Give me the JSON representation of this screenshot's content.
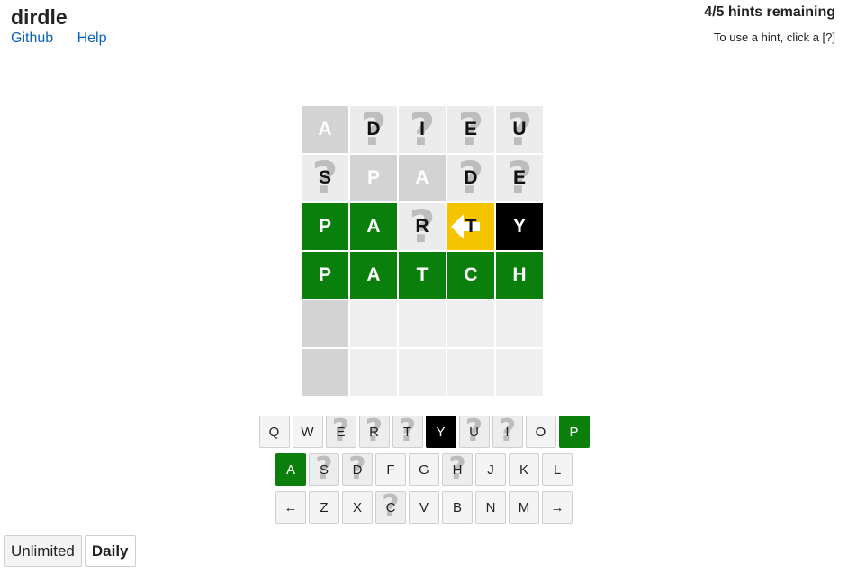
{
  "app": {
    "title": "dirdle"
  },
  "links": [
    {
      "label": "Github"
    },
    {
      "label": "Help"
    }
  ],
  "hints": {
    "remaining": "4/5 hints remaining",
    "help": "To use a hint, click a [?]"
  },
  "colors": {
    "green": "#0b7f0b",
    "yellow": "#f5c400",
    "gray": "#d3d3d3",
    "black": "#000000",
    "link": "#0b62b8"
  },
  "grid": [
    [
      {
        "letter": "A",
        "state": "gray"
      },
      {
        "letter": "D",
        "state": "unknown"
      },
      {
        "letter": "I",
        "state": "unknown"
      },
      {
        "letter": "E",
        "state": "unknown"
      },
      {
        "letter": "U",
        "state": "unknown"
      }
    ],
    [
      {
        "letter": "S",
        "state": "unknown"
      },
      {
        "letter": "P",
        "state": "gray"
      },
      {
        "letter": "A",
        "state": "gray"
      },
      {
        "letter": "D",
        "state": "unknown"
      },
      {
        "letter": "E",
        "state": "unknown"
      }
    ],
    [
      {
        "letter": "P",
        "state": "green"
      },
      {
        "letter": "A",
        "state": "green"
      },
      {
        "letter": "R",
        "state": "unknown"
      },
      {
        "letter": "T",
        "state": "yellow",
        "icon": "left-arrow-icon"
      },
      {
        "letter": "Y",
        "state": "black"
      }
    ],
    [
      {
        "letter": "P",
        "state": "green"
      },
      {
        "letter": "A",
        "state": "green"
      },
      {
        "letter": "T",
        "state": "green"
      },
      {
        "letter": "C",
        "state": "green"
      },
      {
        "letter": "H",
        "state": "green"
      }
    ],
    [
      {
        "letter": "",
        "state": "first-empty"
      },
      {
        "letter": "",
        "state": "empty"
      },
      {
        "letter": "",
        "state": "empty"
      },
      {
        "letter": "",
        "state": "empty"
      },
      {
        "letter": "",
        "state": "empty"
      }
    ],
    [
      {
        "letter": "",
        "state": "first-empty"
      },
      {
        "letter": "",
        "state": "empty"
      },
      {
        "letter": "",
        "state": "empty"
      },
      {
        "letter": "",
        "state": "empty"
      },
      {
        "letter": "",
        "state": "empty"
      }
    ]
  ],
  "keyboard": [
    [
      {
        "key": "Q",
        "state": "plain"
      },
      {
        "key": "W",
        "state": "plain"
      },
      {
        "key": "E",
        "state": "unknown"
      },
      {
        "key": "R",
        "state": "unknown"
      },
      {
        "key": "T",
        "state": "unknown"
      },
      {
        "key": "Y",
        "state": "black"
      },
      {
        "key": "U",
        "state": "unknown"
      },
      {
        "key": "I",
        "state": "unknown"
      },
      {
        "key": "O",
        "state": "plain"
      },
      {
        "key": "P",
        "state": "green"
      }
    ],
    [
      {
        "key": "A",
        "state": "green"
      },
      {
        "key": "S",
        "state": "unknown"
      },
      {
        "key": "D",
        "state": "unknown"
      },
      {
        "key": "F",
        "state": "plain"
      },
      {
        "key": "G",
        "state": "plain"
      },
      {
        "key": "H",
        "state": "unknown"
      },
      {
        "key": "J",
        "state": "plain"
      },
      {
        "key": "K",
        "state": "plain"
      },
      {
        "key": "L",
        "state": "plain"
      }
    ],
    [
      {
        "key": "←",
        "state": "plain"
      },
      {
        "key": "Z",
        "state": "plain"
      },
      {
        "key": "X",
        "state": "plain"
      },
      {
        "key": "C",
        "state": "unknown"
      },
      {
        "key": "V",
        "state": "plain"
      },
      {
        "key": "B",
        "state": "plain"
      },
      {
        "key": "N",
        "state": "plain"
      },
      {
        "key": "M",
        "state": "plain"
      },
      {
        "key": "→",
        "state": "plain"
      }
    ]
  ],
  "modes": [
    {
      "label": "Unlimited",
      "active": false
    },
    {
      "label": "Daily",
      "active": true
    }
  ]
}
